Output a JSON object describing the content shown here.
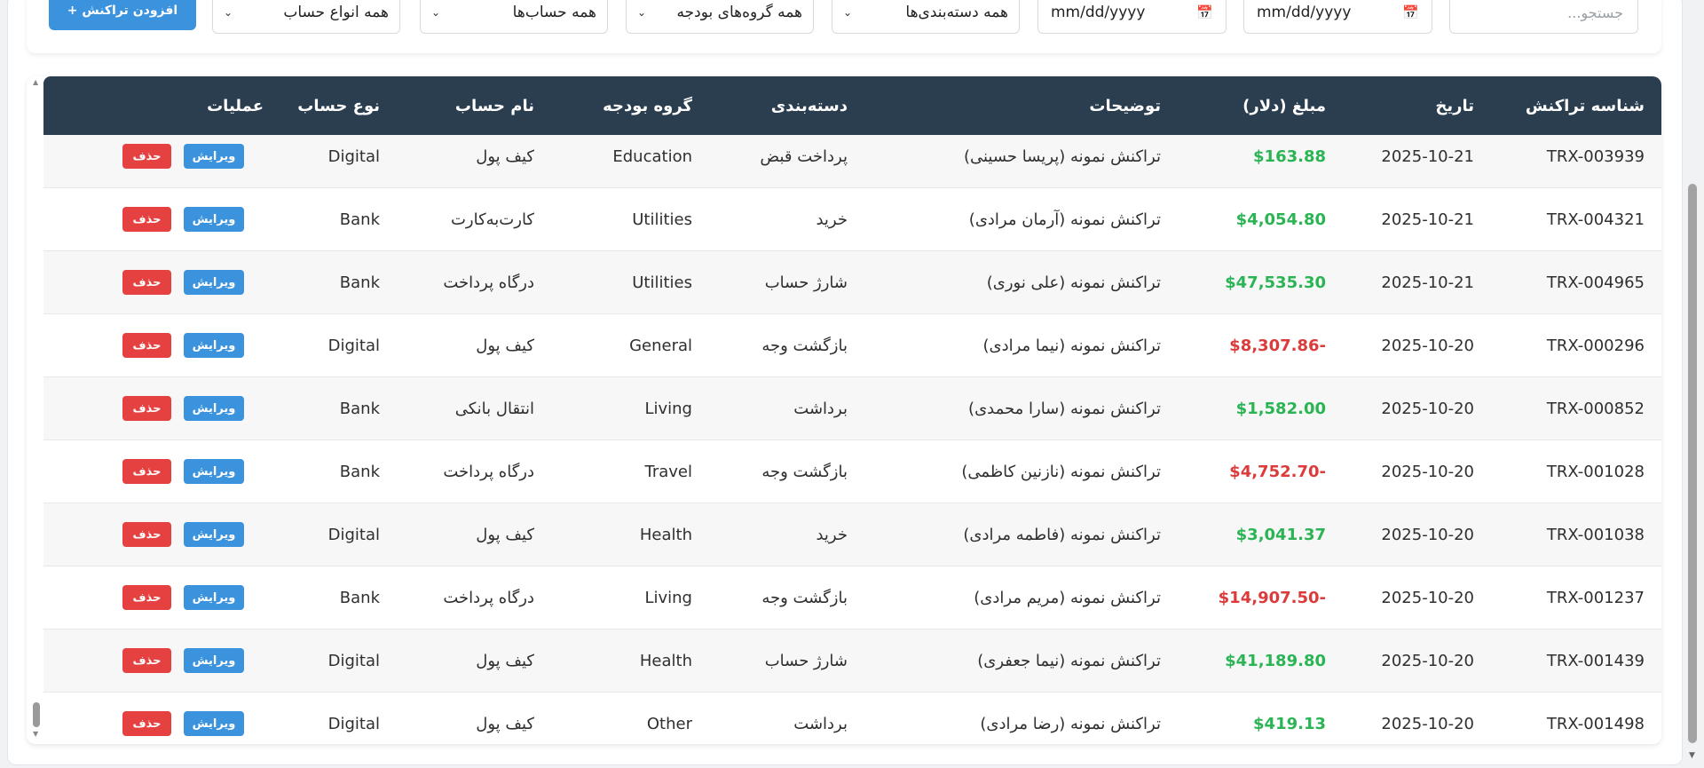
{
  "filters": {
    "search_placeholder": "جستجو...",
    "date_from": "mm/dd/yyyy",
    "date_to": "mm/dd/yyyy",
    "category_select": "همه دسته‌بندی‌ها",
    "budget_group_select": "همه گروه‌های بودجه",
    "account_select": "همه حساب‌ها",
    "account_type_select": "همه انواع حساب",
    "add_button": "+ افزودن تراکنش"
  },
  "table": {
    "headers": {
      "id": "شناسه تراکنش",
      "date": "تاریخ",
      "amount": "مبلغ (دلار)",
      "description": "توضیحات",
      "category": "دسته‌بندی",
      "budget_group": "گروه بودجه",
      "account_name": "نام حساب",
      "account_type": "نوع حساب",
      "actions": "عملیات"
    },
    "edit_label": "ویرایش",
    "delete_label": "حذف",
    "rows": [
      {
        "id": "TRX-003939",
        "date": "2025-10-21",
        "amount": "$163.88",
        "sign": "pos",
        "description": "تراکنش نمونه (پریسا حسینی)",
        "category": "پرداخت قبض",
        "budget_group": "Education",
        "account_name": "کیف پول",
        "account_type": "Digital"
      },
      {
        "id": "TRX-004321",
        "date": "2025-10-21",
        "amount": "$4,054.80",
        "sign": "pos",
        "description": "تراکنش نمونه (آرمان مرادی)",
        "category": "خرید",
        "budget_group": "Utilities",
        "account_name": "کارت‌به‌کارت",
        "account_type": "Bank"
      },
      {
        "id": "TRX-004965",
        "date": "2025-10-21",
        "amount": "$47,535.30",
        "sign": "pos",
        "description": "تراکنش نمونه (علی نوری)",
        "category": "شارژ حساب",
        "budget_group": "Utilities",
        "account_name": "درگاه پرداخت",
        "account_type": "Bank"
      },
      {
        "id": "TRX-000296",
        "date": "2025-10-20",
        "amount": "$8,307.86-",
        "sign": "neg",
        "description": "تراکنش نمونه (نیما مرادی)",
        "category": "بازگشت وجه",
        "budget_group": "General",
        "account_name": "کیف پول",
        "account_type": "Digital"
      },
      {
        "id": "TRX-000852",
        "date": "2025-10-20",
        "amount": "$1,582.00",
        "sign": "pos",
        "description": "تراکنش نمونه (سارا محمدی)",
        "category": "برداشت",
        "budget_group": "Living",
        "account_name": "انتقال بانکی",
        "account_type": "Bank"
      },
      {
        "id": "TRX-001028",
        "date": "2025-10-20",
        "amount": "$4,752.70-",
        "sign": "neg",
        "description": "تراکنش نمونه (نازنین کاظمی)",
        "category": "بازگشت وجه",
        "budget_group": "Travel",
        "account_name": "درگاه پرداخت",
        "account_type": "Bank"
      },
      {
        "id": "TRX-001038",
        "date": "2025-10-20",
        "amount": "$3,041.37",
        "sign": "pos",
        "description": "تراکنش نمونه (فاطمه مرادی)",
        "category": "خرید",
        "budget_group": "Health",
        "account_name": "کیف پول",
        "account_type": "Digital"
      },
      {
        "id": "TRX-001237",
        "date": "2025-10-20",
        "amount": "$14,907.50-",
        "sign": "neg",
        "description": "تراکنش نمونه (مریم مرادی)",
        "category": "بازگشت وجه",
        "budget_group": "Living",
        "account_name": "درگاه پرداخت",
        "account_type": "Bank"
      },
      {
        "id": "TRX-001439",
        "date": "2025-10-20",
        "amount": "$41,189.80",
        "sign": "pos",
        "description": "تراکنش نمونه (نیما جعفری)",
        "category": "شارژ حساب",
        "budget_group": "Health",
        "account_name": "کیف پول",
        "account_type": "Digital"
      },
      {
        "id": "TRX-001498",
        "date": "2025-10-20",
        "amount": "$419.13",
        "sign": "pos",
        "description": "تراکنش نمونه (رضا مرادی)",
        "category": "برداشت",
        "budget_group": "Other",
        "account_name": "کیف پول",
        "account_type": "Digital"
      }
    ]
  },
  "colors": {
    "header_bg": "#2b3e50",
    "positive": "#2ab454",
    "negative": "#dc3b3b",
    "edit_button": "#3b93de",
    "delete_button": "#e54141"
  }
}
